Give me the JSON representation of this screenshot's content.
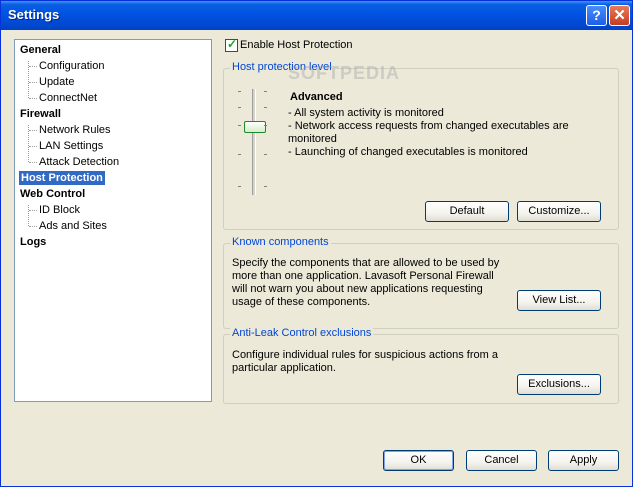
{
  "window": {
    "title": "Settings",
    "help_label": "?",
    "close_label": "✕"
  },
  "tree": {
    "items": [
      {
        "label": "General",
        "level": 0
      },
      {
        "label": "Configuration",
        "level": 1
      },
      {
        "label": "Update",
        "level": 1
      },
      {
        "label": "ConnectNet",
        "level": 1
      },
      {
        "label": "Firewall",
        "level": 0
      },
      {
        "label": "Network Rules",
        "level": 1
      },
      {
        "label": "LAN Settings",
        "level": 1
      },
      {
        "label": "Attack Detection",
        "level": 1
      },
      {
        "label": "Host Protection",
        "level": 0,
        "selected": true
      },
      {
        "label": "Web Control",
        "level": 0
      },
      {
        "label": "ID Block",
        "level": 1
      },
      {
        "label": "Ads and Sites",
        "level": 1
      },
      {
        "label": "Logs",
        "level": 0
      }
    ]
  },
  "enable": {
    "label": "Enable Host Protection",
    "checked": true
  },
  "level_group": {
    "title": "Host protection level",
    "level_name": "Advanced",
    "lines": [
      "- All system activity is monitored",
      "- Network access requests from changed executables are monitored",
      "- Launching of changed executables is monitored"
    ],
    "default_label": "Default",
    "customize_label": "Customize..."
  },
  "known_group": {
    "title": "Known components",
    "text": "Specify the components that are allowed to be used by more than one application. Lavasoft Personal Firewall will not warn you about new applications requesting usage of these components.",
    "view_label": "View List..."
  },
  "antileak_group": {
    "title": "Anti-Leak Control exclusions",
    "text": "Configure individual rules for suspicious actions from a particular application.",
    "exclusions_label": "Exclusions..."
  },
  "footer": {
    "ok_label": "OK",
    "cancel_label": "Cancel",
    "apply_label": "Apply"
  },
  "watermark": "SOFTPEDIA"
}
